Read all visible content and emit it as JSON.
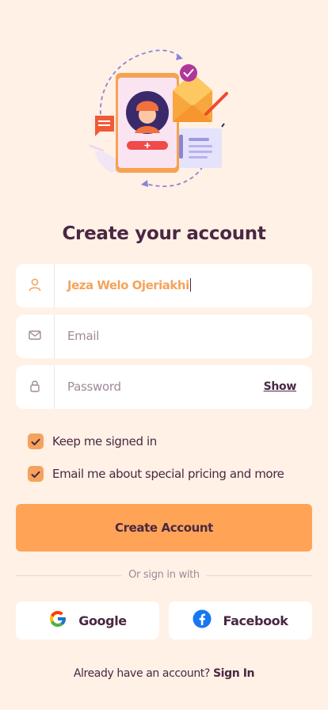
{
  "title": "Create your account",
  "fields": {
    "name": {
      "value": "Jeza Welo Ojeriakhi"
    },
    "email": {
      "placeholder": "Email"
    },
    "password": {
      "placeholder": "Password",
      "toggle_label": "Show"
    }
  },
  "options": {
    "keep_signed_in": {
      "label": "Keep me signed in",
      "checked": true
    },
    "email_pricing": {
      "label": "Email me about special pricing and more",
      "checked": true
    }
  },
  "primary_button": "Create Account",
  "divider_text": "Or sign in with",
  "social": {
    "google": "Google",
    "facebook": "Facebook"
  },
  "footer": {
    "prompt": "Already have an account?",
    "link": "Sign In"
  },
  "colors": {
    "background": "#fff1e6",
    "accent": "#ffa456",
    "text": "#4a2742",
    "placeholder": "#9f8a98"
  },
  "icons": [
    "user-icon",
    "mail-icon",
    "lock-icon",
    "check-icon",
    "google-icon",
    "facebook-icon"
  ]
}
